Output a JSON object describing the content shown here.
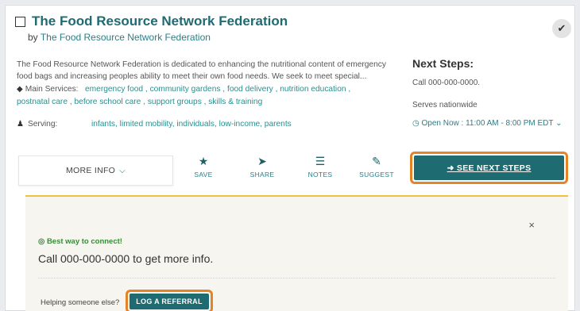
{
  "header": {
    "title": "The Food Resource Network Federation",
    "by_prefix": "by",
    "by_org": "The Food Resource Network Federation",
    "check_icon": "✔"
  },
  "description": "The Food Resource Network Federation is dedicated to enhancing the nutritional content of emergency food bags and increasing peoples ability to meet their own food needs. We seek to meet special...",
  "services": {
    "label": "Main Services:",
    "items": [
      "emergency food ,",
      "community gardens ,",
      "food delivery ,",
      "nutrition education ,",
      "postnatal care ,",
      "before school care ,",
      "support groups ,",
      "skills & training"
    ]
  },
  "serving": {
    "label": "Serving:",
    "value": "infants, limited mobility, individuals, low-income, parents"
  },
  "next_steps": {
    "title": "Next Steps:",
    "phone": "Call 000-000-0000.",
    "serves": "Serves nationwide",
    "open_now": "Open Now : 11:00 AM - 8:00 PM EDT"
  },
  "actions": {
    "more_info": "MORE INFO",
    "save": "SAVE",
    "share": "SHARE",
    "notes": "NOTES",
    "suggest": "SUGGEST",
    "see_next_steps": "SEE NEXT STEPS"
  },
  "panel": {
    "close": "×",
    "best_way": "Best way to connect!",
    "call_text": "Call 000-000-0000 to get more info.",
    "helping": "Helping someone else?",
    "log_referral": "LOG A REFERRAL"
  },
  "colors": {
    "accent_teal": "#1f6b72",
    "link_teal": "#2a8f8f",
    "highlight_orange": "#e58327",
    "panel_border_yellow": "#f0c040"
  }
}
